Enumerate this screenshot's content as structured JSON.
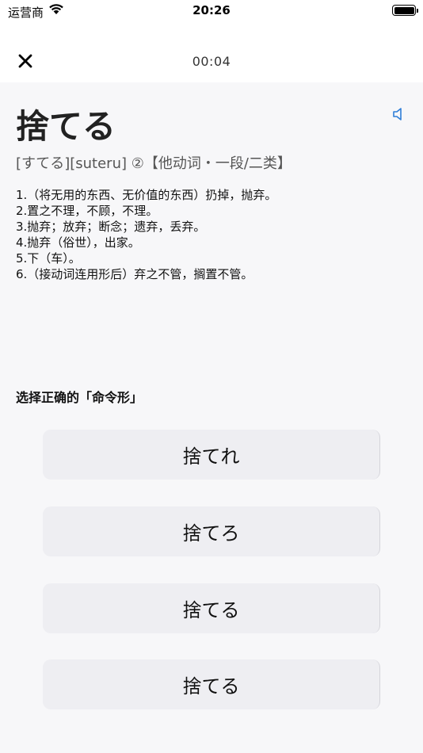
{
  "status_bar": {
    "carrier": "运营商",
    "time": "20:26"
  },
  "header": {
    "timer": "00:04"
  },
  "word": {
    "kanji": "捨てる",
    "reading": "[すてる][suteru] ②【他动词・一段/二类】"
  },
  "meanings": [
    "1.（将无用的东西、无价值的东西）扔掉，抛弃。",
    "2.置之不理，不顾，不理。",
    "3.抛弃；放弃；断念；遗弃，丢弃。",
    "4.抛弃（俗世），出家。",
    "5.下（车）。",
    "6.（接动词连用形后）弃之不管，搁置不管。"
  ],
  "quiz": {
    "prompt": "选择正确的「命令形」",
    "options": [
      "捨てれ",
      "捨てろ",
      "捨てる",
      "捨てる"
    ]
  },
  "colors": {
    "accent": "#2f7ed8",
    "option_bg": "#eeeef2",
    "page_bg": "#f7f7f9"
  }
}
